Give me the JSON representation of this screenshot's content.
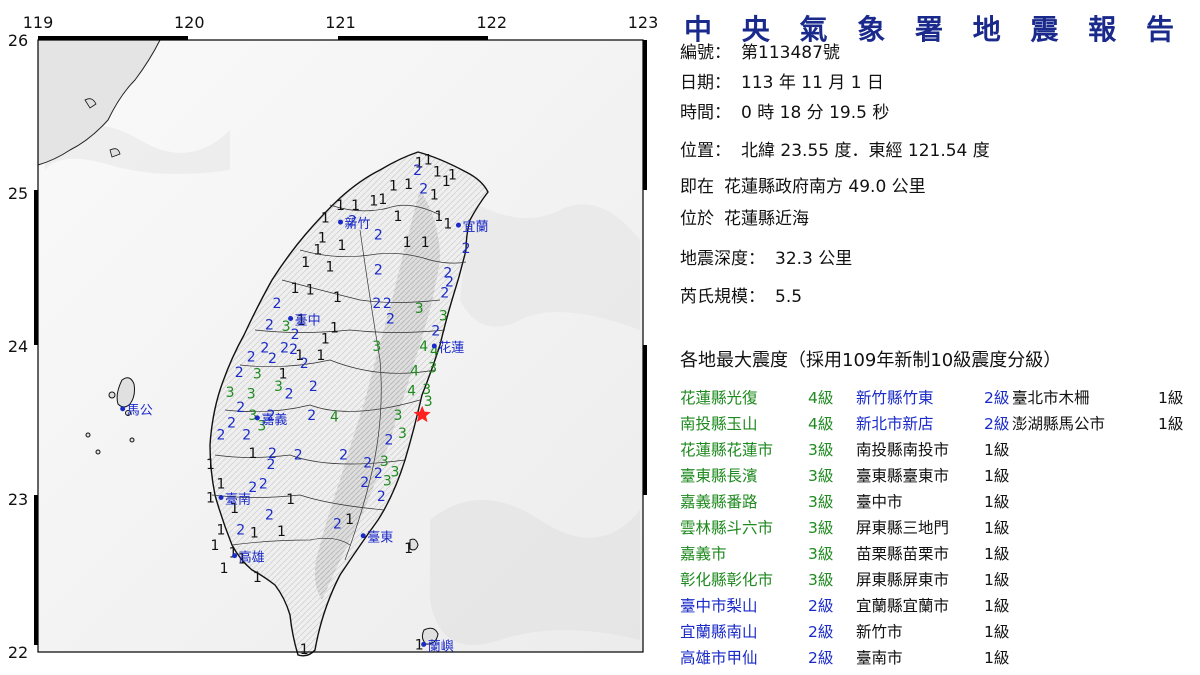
{
  "map": {
    "lon_ticks": [
      "119",
      "120",
      "121",
      "122",
      "123"
    ],
    "lat_ticks": [
      "26",
      "25",
      "24",
      "23",
      "22"
    ],
    "city_labels": [
      {
        "name": "新竹",
        "lon": 121.0,
        "lat": 24.81
      },
      {
        "name": "宜蘭",
        "lon": 121.78,
        "lat": 24.79
      },
      {
        "name": "臺中",
        "lon": 120.67,
        "lat": 24.18
      },
      {
        "name": "花蓮",
        "lon": 121.62,
        "lat": 24.0
      },
      {
        "name": "馬公",
        "lon": 119.56,
        "lat": 23.59
      },
      {
        "name": "嘉義",
        "lon": 120.45,
        "lat": 23.53
      },
      {
        "name": "臺南",
        "lon": 120.21,
        "lat": 23.01
      },
      {
        "name": "臺東",
        "lon": 121.15,
        "lat": 22.76
      },
      {
        "name": "高雄",
        "lon": 120.3,
        "lat": 22.63
      },
      {
        "name": "蘭嶼",
        "lon": 121.55,
        "lat": 22.05
      }
    ],
    "epicenter": {
      "lat": 23.55,
      "lon": 121.54,
      "color": "#ff2020"
    },
    "intensity_colors": {
      "1": "#111111",
      "2": "#1a2ac8",
      "3": "#1f8a1f",
      "4": "#1f8a1f"
    },
    "stations": [
      {
        "v": "1",
        "lon": 121.52,
        "lat": 25.2
      },
      {
        "v": "1",
        "lon": 121.58,
        "lat": 25.22
      },
      {
        "v": "2",
        "lon": 121.51,
        "lat": 25.15
      },
      {
        "v": "1",
        "lon": 121.64,
        "lat": 25.14
      },
      {
        "v": "1",
        "lon": 121.7,
        "lat": 25.08
      },
      {
        "v": "1",
        "lon": 121.74,
        "lat": 25.12
      },
      {
        "v": "1",
        "lon": 121.45,
        "lat": 25.06
      },
      {
        "v": "1",
        "lon": 121.35,
        "lat": 25.05
      },
      {
        "v": "2",
        "lon": 121.55,
        "lat": 25.03
      },
      {
        "v": "1",
        "lon": 121.62,
        "lat": 24.99
      },
      {
        "v": "1",
        "lon": 121.28,
        "lat": 24.96
      },
      {
        "v": "1",
        "lon": 121.22,
        "lat": 24.95
      },
      {
        "v": "1",
        "lon": 121.1,
        "lat": 24.92
      },
      {
        "v": "1",
        "lon": 121.0,
        "lat": 24.92
      },
      {
        "v": "1",
        "lon": 120.9,
        "lat": 24.84
      },
      {
        "v": "2",
        "lon": 121.08,
        "lat": 24.82
      },
      {
        "v": "1",
        "lon": 121.38,
        "lat": 24.85
      },
      {
        "v": "1",
        "lon": 121.65,
        "lat": 24.85
      },
      {
        "v": "1",
        "lon": 121.71,
        "lat": 24.8
      },
      {
        "v": "1",
        "lon": 120.88,
        "lat": 24.71
      },
      {
        "v": "2",
        "lon": 121.25,
        "lat": 24.73
      },
      {
        "v": "1",
        "lon": 121.44,
        "lat": 24.68
      },
      {
        "v": "1",
        "lon": 121.56,
        "lat": 24.68
      },
      {
        "v": "2",
        "lon": 121.83,
        "lat": 24.64
      },
      {
        "v": "1",
        "lon": 120.85,
        "lat": 24.63
      },
      {
        "v": "1",
        "lon": 121.01,
        "lat": 24.66
      },
      {
        "v": "1",
        "lon": 120.77,
        "lat": 24.55
      },
      {
        "v": "1",
        "lon": 120.93,
        "lat": 24.52
      },
      {
        "v": "2",
        "lon": 121.25,
        "lat": 24.5
      },
      {
        "v": "2",
        "lon": 121.71,
        "lat": 24.48
      },
      {
        "v": "1",
        "lon": 120.7,
        "lat": 24.38
      },
      {
        "v": "1",
        "lon": 120.8,
        "lat": 24.37
      },
      {
        "v": "2",
        "lon": 121.72,
        "lat": 24.42
      },
      {
        "v": "2",
        "lon": 121.69,
        "lat": 24.35
      },
      {
        "v": "1",
        "lon": 120.98,
        "lat": 24.32
      },
      {
        "v": "2",
        "lon": 120.58,
        "lat": 24.28
      },
      {
        "v": "2",
        "lon": 121.24,
        "lat": 24.28
      },
      {
        "v": "2",
        "lon": 121.31,
        "lat": 24.28
      },
      {
        "v": "3",
        "lon": 121.52,
        "lat": 24.25
      },
      {
        "v": "2",
        "lon": 121.33,
        "lat": 24.18
      },
      {
        "v": "3",
        "lon": 121.68,
        "lat": 24.2
      },
      {
        "v": "2",
        "lon": 120.53,
        "lat": 24.14
      },
      {
        "v": "3",
        "lon": 120.64,
        "lat": 24.13
      },
      {
        "v": "1",
        "lon": 120.74,
        "lat": 24.17
      },
      {
        "v": "1",
        "lon": 120.96,
        "lat": 24.12
      },
      {
        "v": "2",
        "lon": 120.7,
        "lat": 24.08
      },
      {
        "v": "1",
        "lon": 120.9,
        "lat": 24.05
      },
      {
        "v": "2",
        "lon": 121.63,
        "lat": 24.1
      },
      {
        "v": "2",
        "lon": 120.5,
        "lat": 23.99
      },
      {
        "v": "2",
        "lon": 120.63,
        "lat": 23.99
      },
      {
        "v": "2",
        "lon": 120.69,
        "lat": 23.98
      },
      {
        "v": "3",
        "lon": 121.24,
        "lat": 24.0
      },
      {
        "v": "4",
        "lon": 121.55,
        "lat": 24.0
      },
      {
        "v": "1",
        "lon": 120.73,
        "lat": 23.94
      },
      {
        "v": "1",
        "lon": 120.87,
        "lat": 23.94
      },
      {
        "v": "4",
        "lon": 121.62,
        "lat": 23.97
      },
      {
        "v": "2",
        "lon": 120.41,
        "lat": 23.93
      },
      {
        "v": "2",
        "lon": 120.55,
        "lat": 23.92
      },
      {
        "v": "2",
        "lon": 120.76,
        "lat": 23.89
      },
      {
        "v": "3",
        "lon": 121.61,
        "lat": 23.86
      },
      {
        "v": "2",
        "lon": 120.33,
        "lat": 23.83
      },
      {
        "v": "3",
        "lon": 120.45,
        "lat": 23.82
      },
      {
        "v": "1",
        "lon": 120.62,
        "lat": 23.82
      },
      {
        "v": "4",
        "lon": 121.49,
        "lat": 23.84
      },
      {
        "v": "3",
        "lon": 120.59,
        "lat": 23.74
      },
      {
        "v": "2",
        "lon": 120.82,
        "lat": 23.74
      },
      {
        "v": "3",
        "lon": 120.27,
        "lat": 23.7
      },
      {
        "v": "3",
        "lon": 120.41,
        "lat": 23.69
      },
      {
        "v": "2",
        "lon": 120.66,
        "lat": 23.69
      },
      {
        "v": "4",
        "lon": 121.47,
        "lat": 23.71
      },
      {
        "v": "3",
        "lon": 121.57,
        "lat": 23.72
      },
      {
        "v": "3",
        "lon": 121.58,
        "lat": 23.64
      },
      {
        "v": "2",
        "lon": 120.34,
        "lat": 23.6
      },
      {
        "v": "3",
        "lon": 120.42,
        "lat": 23.55
      },
      {
        "v": "2",
        "lon": 120.54,
        "lat": 23.55
      },
      {
        "v": "2",
        "lon": 120.81,
        "lat": 23.55
      },
      {
        "v": "4",
        "lon": 120.96,
        "lat": 23.54
      },
      {
        "v": "3",
        "lon": 121.38,
        "lat": 23.55
      },
      {
        "v": "2",
        "lon": 120.28,
        "lat": 23.5
      },
      {
        "v": "3",
        "lon": 120.48,
        "lat": 23.48
      },
      {
        "v": "2",
        "lon": 120.21,
        "lat": 23.42
      },
      {
        "v": "2",
        "lon": 120.38,
        "lat": 23.42
      },
      {
        "v": "3",
        "lon": 121.41,
        "lat": 23.43
      },
      {
        "v": "2",
        "lon": 121.32,
        "lat": 23.39
      },
      {
        "v": "1",
        "lon": 120.42,
        "lat": 23.3
      },
      {
        "v": "2",
        "lon": 120.55,
        "lat": 23.3
      },
      {
        "v": "2",
        "lon": 120.72,
        "lat": 23.29
      },
      {
        "v": "2",
        "lon": 121.02,
        "lat": 23.29
      },
      {
        "v": "2",
        "lon": 120.54,
        "lat": 23.23
      },
      {
        "v": "1",
        "lon": 120.14,
        "lat": 23.23
      },
      {
        "v": "2",
        "lon": 121.18,
        "lat": 23.24
      },
      {
        "v": "3",
        "lon": 121.29,
        "lat": 23.25
      },
      {
        "v": "2",
        "lon": 121.25,
        "lat": 23.17
      },
      {
        "v": "3",
        "lon": 121.36,
        "lat": 23.18
      },
      {
        "v": "2",
        "lon": 120.49,
        "lat": 23.1
      },
      {
        "v": "1",
        "lon": 120.21,
        "lat": 23.1
      },
      {
        "v": "2",
        "lon": 121.16,
        "lat": 23.11
      },
      {
        "v": "3",
        "lon": 121.31,
        "lat": 23.12
      },
      {
        "v": "2",
        "lon": 120.42,
        "lat": 23.08
      },
      {
        "v": "1",
        "lon": 120.14,
        "lat": 23.01
      },
      {
        "v": "1",
        "lon": 120.67,
        "lat": 23.0
      },
      {
        "v": "2",
        "lon": 121.27,
        "lat": 23.02
      },
      {
        "v": "1",
        "lon": 120.3,
        "lat": 22.94
      },
      {
        "v": "2",
        "lon": 120.53,
        "lat": 22.9
      },
      {
        "v": "1",
        "lon": 121.06,
        "lat": 22.87
      },
      {
        "v": "2",
        "lon": 120.98,
        "lat": 22.84
      },
      {
        "v": "1",
        "lon": 120.21,
        "lat": 22.8
      },
      {
        "v": "2",
        "lon": 120.34,
        "lat": 22.8
      },
      {
        "v": "1",
        "lon": 120.61,
        "lat": 22.79
      },
      {
        "v": "1",
        "lon": 120.43,
        "lat": 22.78
      },
      {
        "v": "1",
        "lon": 120.17,
        "lat": 22.7
      },
      {
        "v": "1",
        "lon": 120.29,
        "lat": 22.65
      },
      {
        "v": "1",
        "lon": 120.35,
        "lat": 22.61
      },
      {
        "v": "1",
        "lon": 121.45,
        "lat": 22.68
      },
      {
        "v": "1",
        "lon": 120.23,
        "lat": 22.55
      },
      {
        "v": "1",
        "lon": 120.45,
        "lat": 22.49
      },
      {
        "v": "1",
        "lon": 120.76,
        "lat": 22.02
      },
      {
        "v": "1",
        "lon": 121.52,
        "lat": 22.05
      }
    ]
  },
  "report": {
    "title": "中 央 氣 象 署 地 震 報 告",
    "fields": [
      {
        "label": "編號：",
        "value": "第113487號"
      },
      {
        "label": "日期：",
        "value": "113 年 11 月 1 日"
      },
      {
        "label": "時間：",
        "value": "0 時 18 分 19.5 秒"
      },
      {
        "label": "位置：",
        "value": "北緯 23.55 度．東經 121.54 度"
      },
      {
        "label": "即在",
        "value": "花蓮縣政府南方 49.0 公里"
      },
      {
        "label": "位於",
        "value": "花蓮縣近海"
      },
      {
        "label": "地震深度：",
        "value": "32.3 公里"
      },
      {
        "label": "芮氏規模：",
        "value": "5.5"
      }
    ],
    "intensity_heading": "各地最大震度（採用109年新制10級震度分級）",
    "columns": [
      [
        {
          "place": "花蓮縣光復",
          "level": "4級",
          "color": "g"
        },
        {
          "place": "南投縣玉山",
          "level": "4級",
          "color": "g"
        },
        {
          "place": "花蓮縣花蓮市",
          "level": "3級",
          "color": "g"
        },
        {
          "place": "臺東縣長濱",
          "level": "3級",
          "color": "g"
        },
        {
          "place": "嘉義縣番路",
          "level": "3級",
          "color": "g"
        },
        {
          "place": "雲林縣斗六市",
          "level": "3級",
          "color": "g"
        },
        {
          "place": "嘉義市",
          "level": "3級",
          "color": "g"
        },
        {
          "place": "彰化縣彰化市",
          "level": "3級",
          "color": "g"
        },
        {
          "place": "臺中市梨山",
          "level": "2級",
          "color": "b"
        },
        {
          "place": "宜蘭縣南山",
          "level": "2級",
          "color": "b"
        },
        {
          "place": "高雄市甲仙",
          "level": "2級",
          "color": "b"
        }
      ],
      [
        {
          "place": "新竹縣竹東",
          "level": "2級",
          "color": "b"
        },
        {
          "place": "新北市新店",
          "level": "2級",
          "color": "b"
        },
        {
          "place": "南投縣南投市",
          "level": "1級",
          "color": "k"
        },
        {
          "place": "臺東縣臺東市",
          "level": "1級",
          "color": "k"
        },
        {
          "place": "臺中市",
          "level": "1級",
          "color": "k"
        },
        {
          "place": "屏東縣三地門",
          "level": "1級",
          "color": "k"
        },
        {
          "place": "苗栗縣苗栗市",
          "level": "1級",
          "color": "k"
        },
        {
          "place": "屏東縣屏東市",
          "level": "1級",
          "color": "k"
        },
        {
          "place": "宜蘭縣宜蘭市",
          "level": "1級",
          "color": "k"
        },
        {
          "place": "新竹市",
          "level": "1級",
          "color": "k"
        },
        {
          "place": "臺南市",
          "level": "1級",
          "color": "k"
        }
      ],
      [
        {
          "place": "臺北市木柵",
          "level": "1級",
          "color": "k"
        },
        {
          "place": "澎湖縣馬公市",
          "level": "1級",
          "color": "k"
        }
      ]
    ]
  }
}
